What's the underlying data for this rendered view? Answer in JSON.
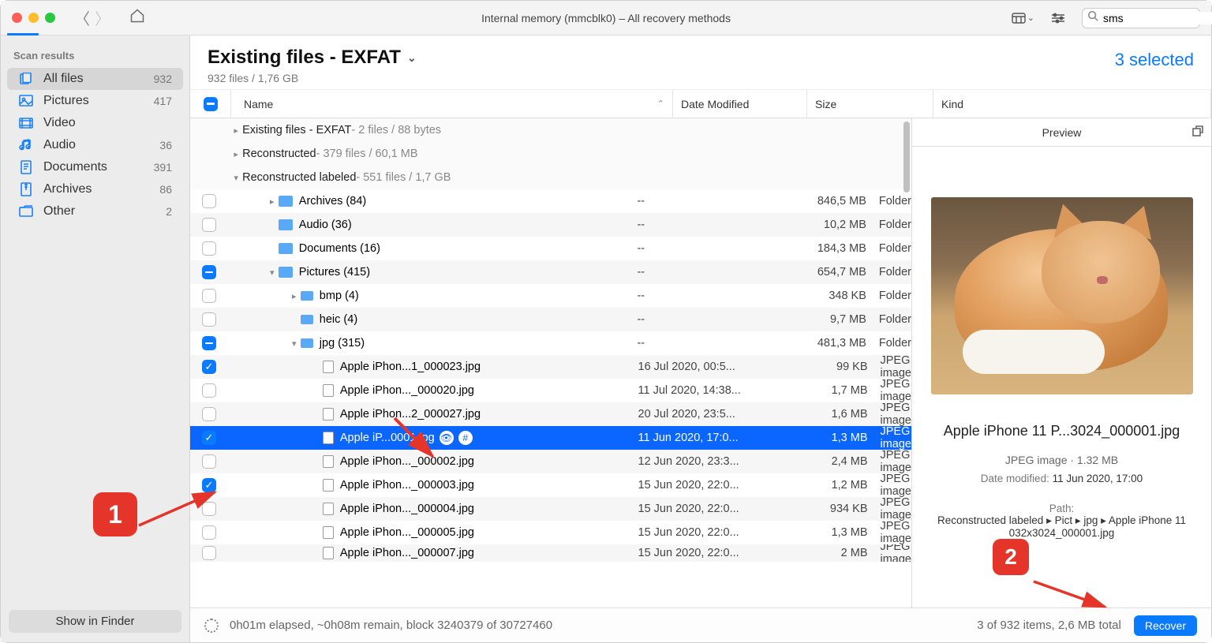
{
  "window": {
    "title": "Internal memory (mmcblk0) – All recovery methods"
  },
  "search": {
    "value": "sms"
  },
  "sidebar": {
    "heading": "Scan results",
    "items": [
      {
        "icon": "files",
        "label": "All files",
        "count": "932",
        "active": true
      },
      {
        "icon": "pictures",
        "label": "Pictures",
        "count": "417"
      },
      {
        "icon": "video",
        "label": "Video",
        "count": ""
      },
      {
        "icon": "audio",
        "label": "Audio",
        "count": "36"
      },
      {
        "icon": "documents",
        "label": "Documents",
        "count": "391"
      },
      {
        "icon": "archives",
        "label": "Archives",
        "count": "86"
      },
      {
        "icon": "other",
        "label": "Other",
        "count": "2"
      }
    ],
    "show_in_finder": "Show in Finder"
  },
  "header": {
    "title": "Existing files - EXFAT",
    "subtitle": "932 files / 1,76 GB",
    "selected": "3 selected"
  },
  "columns": {
    "name": "Name",
    "date": "Date Modified",
    "size": "Size",
    "kind": "Kind"
  },
  "sections": [
    {
      "disc": "right",
      "name": "Existing files - EXFAT",
      "meta": " - 2 files / 88 bytes"
    },
    {
      "disc": "right",
      "name": "Reconstructed",
      "meta": " - 379 files / 60,1 MB"
    },
    {
      "disc": "down",
      "name": "Reconstructed labeled",
      "meta": " - 551 files / 1,7 GB"
    }
  ],
  "rows": [
    {
      "depth": 1,
      "cb": "",
      "disc": "right",
      "type": "folder",
      "name": "Archives (84)",
      "date": "--",
      "size": "846,5 MB",
      "kind": "Folder",
      "stripe": false
    },
    {
      "depth": 1,
      "cb": "",
      "disc": "",
      "type": "folder",
      "name": "Audio (36)",
      "date": "--",
      "size": "10,2 MB",
      "kind": "Folder",
      "stripe": true
    },
    {
      "depth": 1,
      "cb": "",
      "disc": "",
      "type": "folder",
      "name": "Documents (16)",
      "date": "--",
      "size": "184,3 MB",
      "kind": "Folder",
      "stripe": false
    },
    {
      "depth": 1,
      "cb": "ind",
      "disc": "down",
      "type": "folder",
      "name": "Pictures (415)",
      "date": "--",
      "size": "654,7 MB",
      "kind": "Folder",
      "stripe": true
    },
    {
      "depth": 2,
      "cb": "",
      "disc": "right",
      "type": "folder",
      "name": "bmp (4)",
      "date": "--",
      "size": "348 KB",
      "kind": "Folder",
      "stripe": false
    },
    {
      "depth": 2,
      "cb": "",
      "disc": "",
      "type": "folder",
      "name": "heic (4)",
      "date": "--",
      "size": "9,7 MB",
      "kind": "Folder",
      "stripe": true
    },
    {
      "depth": 2,
      "cb": "ind",
      "disc": "down",
      "type": "folder",
      "name": "jpg (315)",
      "date": "--",
      "size": "481,3 MB",
      "kind": "Folder",
      "stripe": false
    },
    {
      "depth": 3,
      "cb": "checked",
      "type": "file",
      "name": "Apple iPhon...1_000023.jpg",
      "date": "16 Jul 2020, 00:5...",
      "size": "99 KB",
      "kind": "JPEG image",
      "stripe": true
    },
    {
      "depth": 3,
      "cb": "",
      "type": "file",
      "name": "Apple iPhon..._000020.jpg",
      "date": "11 Jul 2020, 14:38...",
      "size": "1,7 MB",
      "kind": "JPEG image",
      "stripe": false
    },
    {
      "depth": 3,
      "cb": "",
      "type": "file",
      "name": "Apple iPhon...2_000027.jpg",
      "date": "20 Jul 2020, 23:5...",
      "size": "1,6 MB",
      "kind": "JPEG image",
      "stripe": true
    },
    {
      "depth": 3,
      "cb": "checked",
      "type": "file",
      "name": "Apple iP...0001.jpg",
      "date": "11 Jun 2020, 17:0...",
      "size": "1,3 MB",
      "kind": "JPEG image",
      "selected": true,
      "badges": true
    },
    {
      "depth": 3,
      "cb": "",
      "type": "file",
      "name": "Apple iPhon..._000002.jpg",
      "date": "12 Jun 2020, 23:3...",
      "size": "2,4 MB",
      "kind": "JPEG image",
      "stripe": true
    },
    {
      "depth": 3,
      "cb": "checked",
      "type": "file",
      "name": "Apple iPhon..._000003.jpg",
      "date": "15 Jun 2020, 22:0...",
      "size": "1,2 MB",
      "kind": "JPEG image",
      "stripe": false
    },
    {
      "depth": 3,
      "cb": "",
      "type": "file",
      "name": "Apple iPhon..._000004.jpg",
      "date": "15 Jun 2020, 22:0...",
      "size": "934 KB",
      "kind": "JPEG image",
      "stripe": true
    },
    {
      "depth": 3,
      "cb": "",
      "type": "file",
      "name": "Apple iPhon..._000005.jpg",
      "date": "15 Jun 2020, 22:0...",
      "size": "1,3 MB",
      "kind": "JPEG image",
      "stripe": false
    },
    {
      "depth": 3,
      "cb": "",
      "type": "file",
      "name": "Apple iPhon..._000007.jpg",
      "date": "15 Jun 2020, 22:0...",
      "size": "2 MB",
      "kind": "JPEG image",
      "stripe": true,
      "cut": true
    }
  ],
  "preview": {
    "heading": "Preview",
    "filename": "Apple iPhone 11 P...3024_000001.jpg",
    "meta": "JPEG image · 1.32 MB",
    "date_label": "Date modified:",
    "date_value": "11 Jun 2020, 17:00",
    "path_label": "Path:",
    "path_value": "Reconstructed labeled ▸ Pict          ▸ jpg ▸ Apple iPhone 11          032x3024_000001.jpg"
  },
  "status": {
    "text": "0h01m elapsed, ~0h08m remain, block 3240379 of 30727460",
    "right": "3 of 932 items, 2,6 MB total",
    "recover": "Recover"
  },
  "annotations": {
    "a1": "1",
    "a2": "2"
  }
}
